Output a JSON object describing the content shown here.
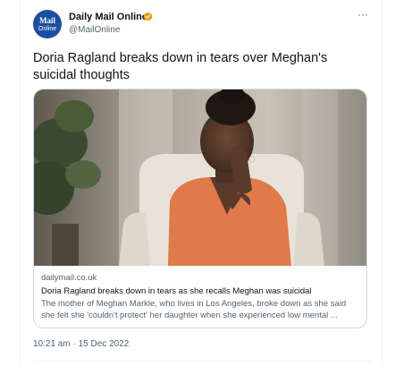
{
  "account": {
    "avatar_line1": "Mail",
    "avatar_line2": "Online",
    "name": "Daily Mail Online",
    "handle": "@MailOnline",
    "verified_color": "#e8a317"
  },
  "more_menu": {
    "icon": "more-horizontal-icon",
    "label": "···"
  },
  "tweet": {
    "text": "Doria Ragland breaks down in tears over Meghan's suicidal thoughts",
    "timestamp": "10:21 am · 15 Dec 2022"
  },
  "card": {
    "domain": "dailymail.co.uk",
    "title": "Doria Ragland breaks down in tears as she recalls Meghan was suicidal",
    "description": "The mother of Meghan Markle, who lives in Los Angeles, broke down as she said she felt she 'couldn't protect' her daughter when she experienced low mental ..."
  },
  "colors": {
    "text": "#0f1419",
    "muted": "#536471",
    "border": "#cfd9de",
    "brand": "#1d4f9e"
  }
}
